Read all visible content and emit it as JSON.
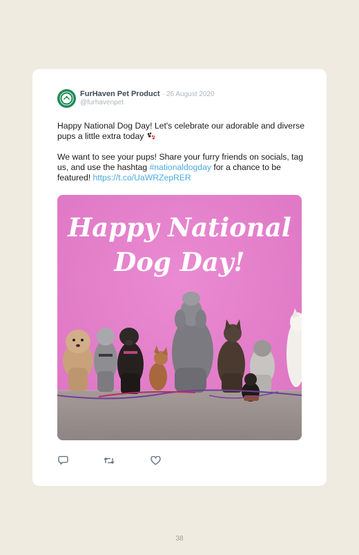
{
  "post": {
    "author": {
      "display_name": "FurHaven Pet Product",
      "separator": "·",
      "date": "26 August 2020",
      "handle": "@furhavenpet"
    },
    "paragraph1": "Happy National Dog Day! Let's celebrate our adorable and diverse pups a little extra today",
    "paragraph2_prefix": "We want to see your pups! Share your furry friends on socials, tag us, and use the hashtag ",
    "hashtag": "#nationaldogday",
    "paragraph2_middle": " for a chance to be featured! ",
    "link": "https://t.co/UaWRZepRER",
    "image": {
      "headline_line1": "Happy National",
      "headline_line2": "Dog Day!",
      "background_color": "#e47ec9"
    },
    "actions": [
      {
        "name": "reply",
        "icon": "reply-icon"
      },
      {
        "name": "retweet",
        "icon": "retweet-icon"
      },
      {
        "name": "like",
        "icon": "heart-icon"
      }
    ]
  },
  "page_number": "38",
  "colors": {
    "page_background": "#efebe1",
    "card_background": "#ffffff",
    "link": "#4aa9df",
    "avatar": "#1f8a5a"
  }
}
